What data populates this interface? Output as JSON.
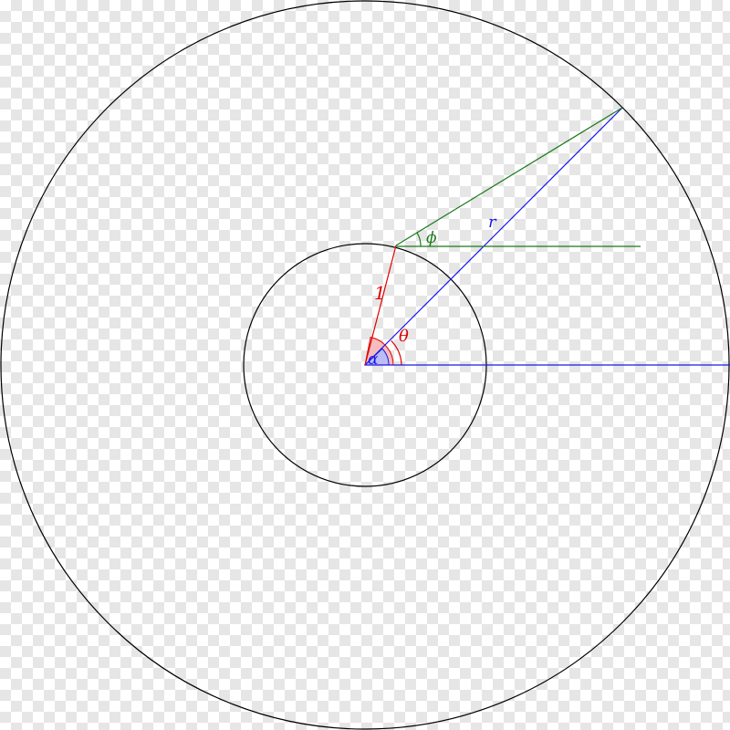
{
  "diagram": {
    "labels": {
      "unit_radius": "1",
      "radius": "r",
      "angle_alpha": "α",
      "angle_theta": "θ",
      "angle_phi": "ϕ"
    },
    "colors": {
      "background_check": "#e6e6e6",
      "outline": "#000000",
      "red": "#e00000",
      "blue": "#1a1ae6",
      "green": "#1a7a1a",
      "red_fill": "#f7bcbc",
      "blue_fill": "#bcbcf7"
    }
  }
}
